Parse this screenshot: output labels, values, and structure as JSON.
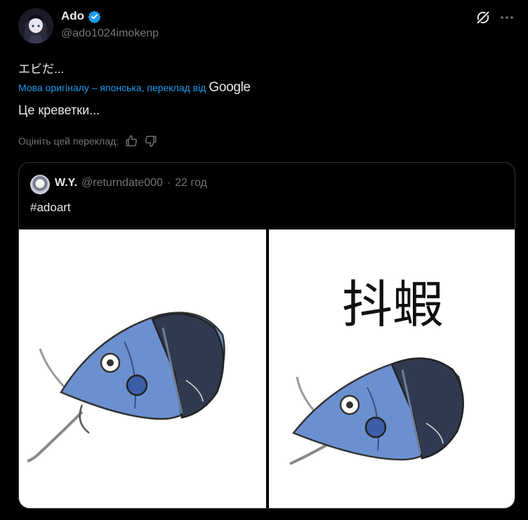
{
  "author": {
    "display_name": "Ado",
    "handle": "@ado1024imokenp"
  },
  "post": {
    "original_text": "エビだ...",
    "translation_note": "Мова оригіналу – японська, переклад від",
    "translation_provider": "Google",
    "translated_text": "Це креветки...",
    "rate_prompt": "Оцініть цей переклад:"
  },
  "quote": {
    "display_name": "W.Y.",
    "handle": "@returndate000",
    "separator": "·",
    "time": "22 год",
    "text": "#adoart",
    "image2_caption": "抖蝦"
  },
  "colors": {
    "accent": "#1d9bf0",
    "muted": "#71767b",
    "text": "#e7e9ea",
    "shrimp_blue": "#5f86c9",
    "shrimp_dark": "#2c3548"
  },
  "icons": {
    "verified": "verified-badge-icon",
    "grok": "grok-icon",
    "more": "more-horizontal-icon",
    "like": "thumbs-up-icon",
    "dislike": "thumbs-down-icon"
  }
}
